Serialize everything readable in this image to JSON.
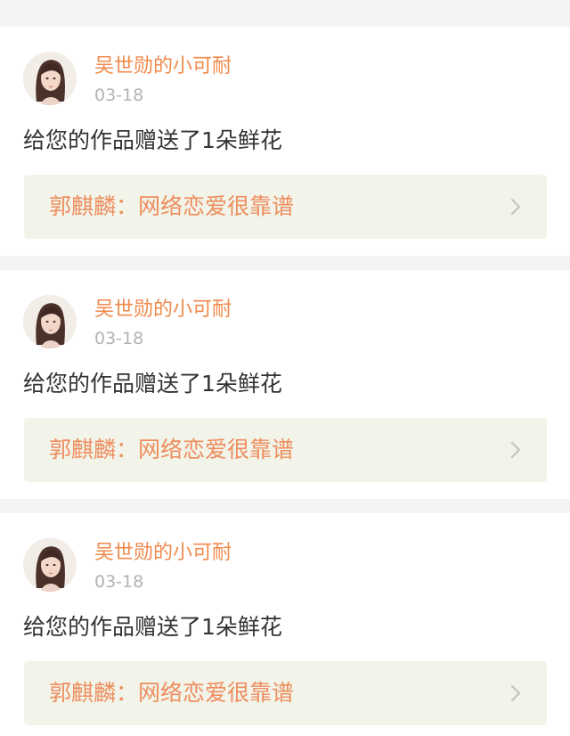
{
  "feed": {
    "items": [
      {
        "avatar_icon": "user-avatar-photo",
        "username": "吴世勋的小可耐",
        "time": "03-18",
        "message": "给您的作品赠送了1朵鲜花",
        "work_title": "郭麒麟：网络恋爱很靠谱",
        "chevron_icon": "chevron-right-icon"
      },
      {
        "avatar_icon": "user-avatar-photo",
        "username": "吴世勋的小可耐",
        "time": "03-18",
        "message": "给您的作品赠送了1朵鲜花",
        "work_title": "郭麒麟：网络恋爱很靠谱",
        "chevron_icon": "chevron-right-icon"
      },
      {
        "avatar_icon": "user-avatar-photo",
        "username": "吴世勋的小可耐",
        "time": "03-18",
        "message": "给您的作品赠送了1朵鲜花",
        "work_title": "郭麒麟：网络恋爱很靠谱",
        "chevron_icon": "chevron-right-icon"
      }
    ]
  },
  "colors": {
    "page_background": "#f4f4f4",
    "card_background": "#ffffff",
    "username": "#f08a4b",
    "time": "#b3b3b3",
    "message": "#333333",
    "work_link_background": "#f2f4ea",
    "work_title": "#ee8d5d",
    "chevron": "#c4c4c4"
  }
}
